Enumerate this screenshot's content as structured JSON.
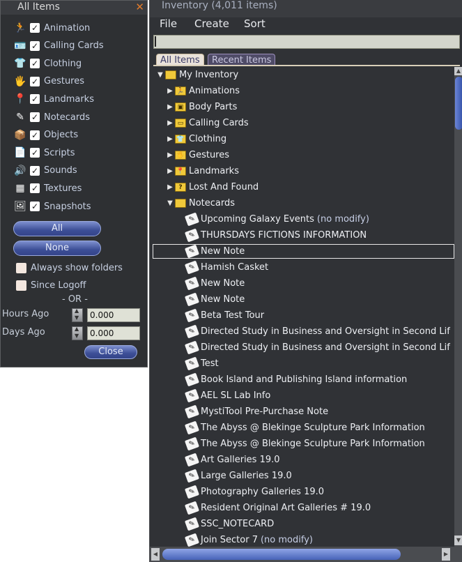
{
  "filter_panel": {
    "title": "All Items",
    "close_glyph": "✕",
    "types": [
      {
        "label": "Animation",
        "icon": "running-figure-icon",
        "glyph": "🏃"
      },
      {
        "label": "Calling Cards",
        "icon": "calling-card-icon",
        "glyph": "🪪"
      },
      {
        "label": "Clothing",
        "icon": "shirt-icon",
        "glyph": "👕"
      },
      {
        "label": "Gestures",
        "icon": "gesture-icon",
        "glyph": "🖐"
      },
      {
        "label": "Landmarks",
        "icon": "landmark-pin-icon",
        "glyph": "📍"
      },
      {
        "label": "Notecards",
        "icon": "notecard-icon",
        "glyph": "✎"
      },
      {
        "label": "Objects",
        "icon": "cube-icon",
        "glyph": "📦"
      },
      {
        "label": "Scripts",
        "icon": "script-icon",
        "glyph": "📄"
      },
      {
        "label": "Sounds",
        "icon": "speaker-icon",
        "glyph": "🔊"
      },
      {
        "label": "Textures",
        "icon": "texture-icon",
        "glyph": "▦"
      },
      {
        "label": "Snapshots",
        "icon": "snapshot-icon",
        "glyph": "🖼"
      }
    ],
    "all_button": "All",
    "none_button": "None",
    "always_show_folders": "Always show folders",
    "since_logoff": "Since Logoff",
    "or_label": "- OR -",
    "hours_ago_label": "Hours Ago",
    "hours_ago_value": "0.000",
    "days_ago_label": "Days Ago",
    "days_ago_value": "0.000",
    "close_button": "Close"
  },
  "inventory": {
    "title": "Inventory (4,011 items)",
    "menu": [
      "File",
      "Create",
      "Sort"
    ],
    "tabs": [
      "All Items",
      "Recent Items"
    ],
    "root": "My Inventory",
    "folders": [
      {
        "name": "Animations",
        "badge": "🏃"
      },
      {
        "name": "Body Parts",
        "badge": "▣"
      },
      {
        "name": "Calling Cards",
        "badge": "▭"
      },
      {
        "name": "Clothing",
        "badge": "👕"
      },
      {
        "name": "Gestures",
        "badge": "🖐"
      },
      {
        "name": "Landmarks",
        "badge": "📍"
      },
      {
        "name": "Lost And Found",
        "badge": "?"
      }
    ],
    "open_folder": "Notecards",
    "notecards": [
      {
        "name": "Upcoming Galaxy Events",
        "suffix": "(no modify)"
      },
      {
        "name": "THURSDAYS FICTIONS INFORMATION",
        "suffix": ""
      },
      {
        "name": "New Note",
        "suffix": ""
      },
      {
        "name": "Hamish Casket",
        "suffix": ""
      },
      {
        "name": "New Note",
        "suffix": ""
      },
      {
        "name": "New Note",
        "suffix": ""
      },
      {
        "name": "Beta Test Tour",
        "suffix": ""
      },
      {
        "name": "Directed Study in Business and Oversight in Second Lif",
        "suffix": ""
      },
      {
        "name": "Directed Study in Business and Oversight in Second Lif",
        "suffix": ""
      },
      {
        "name": "Test",
        "suffix": ""
      },
      {
        "name": "Book Island and Publishing Island information",
        "suffix": ""
      },
      {
        "name": "AEL SL Lab Info",
        "suffix": ""
      },
      {
        "name": "MystiTool Pre-Purchase Note",
        "suffix": ""
      },
      {
        "name": "The Abyss @ Blekinge Sculpture Park Information",
        "suffix": ""
      },
      {
        "name": "The Abyss @ Blekinge Sculpture Park Information",
        "suffix": ""
      },
      {
        "name": "Art Galleries 19.0",
        "suffix": ""
      },
      {
        "name": "Large Galleries 19.0",
        "suffix": ""
      },
      {
        "name": "Photography Galleries 19.0",
        "suffix": ""
      },
      {
        "name": "Resident Original Art Galleries # 19.0",
        "suffix": ""
      },
      {
        "name": "SSC_NOTECARD",
        "suffix": ""
      },
      {
        "name": "Join Sector 7",
        "suffix": "(no modify)"
      }
    ],
    "selected_index": 2
  }
}
